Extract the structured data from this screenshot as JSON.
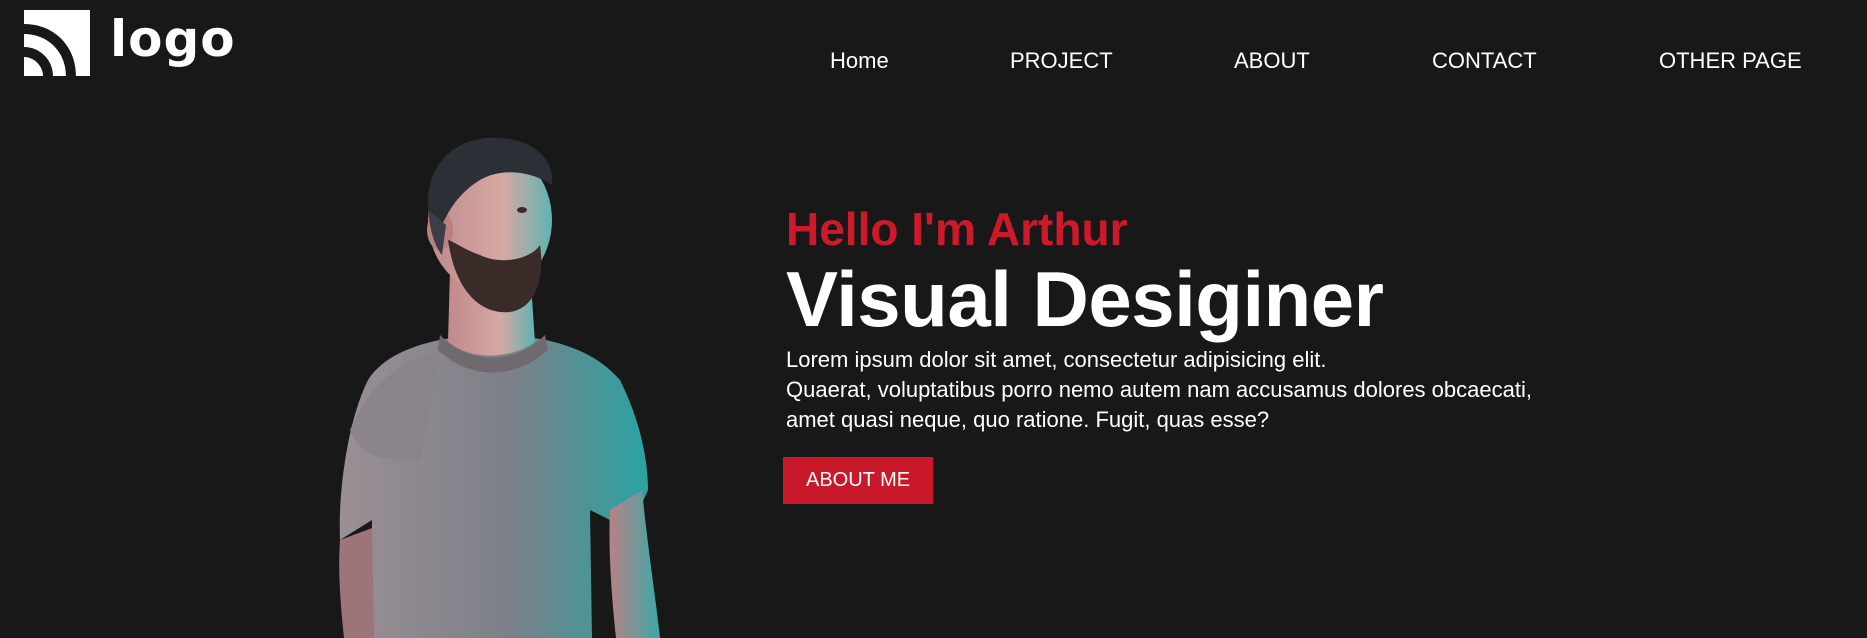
{
  "brand": {
    "logo_text": "logo",
    "logo_icon": "rss-icon"
  },
  "nav": {
    "items": [
      {
        "label": "Home"
      },
      {
        "label": "PROJECT"
      },
      {
        "label": "ABOUT"
      },
      {
        "label": "CONTACT"
      },
      {
        "label": "OTHER PAGE"
      }
    ]
  },
  "hero": {
    "greeting": "Hello I'm Arthur",
    "title": "Visual Desiginer",
    "description_lines": [
      "Lorem ipsum dolor sit amet, consectetur adipisicing elit.",
      "Quaerat, voluptatibus porro nemo autem nam accusamus dolores obcaecati,",
      "amet quasi neque, quo ratione. Fugit, quas esse?"
    ],
    "button_label": "ABOUT ME"
  },
  "colors": {
    "background": "#181818",
    "accent": "#cc1a2a",
    "text": "#ffffff"
  }
}
